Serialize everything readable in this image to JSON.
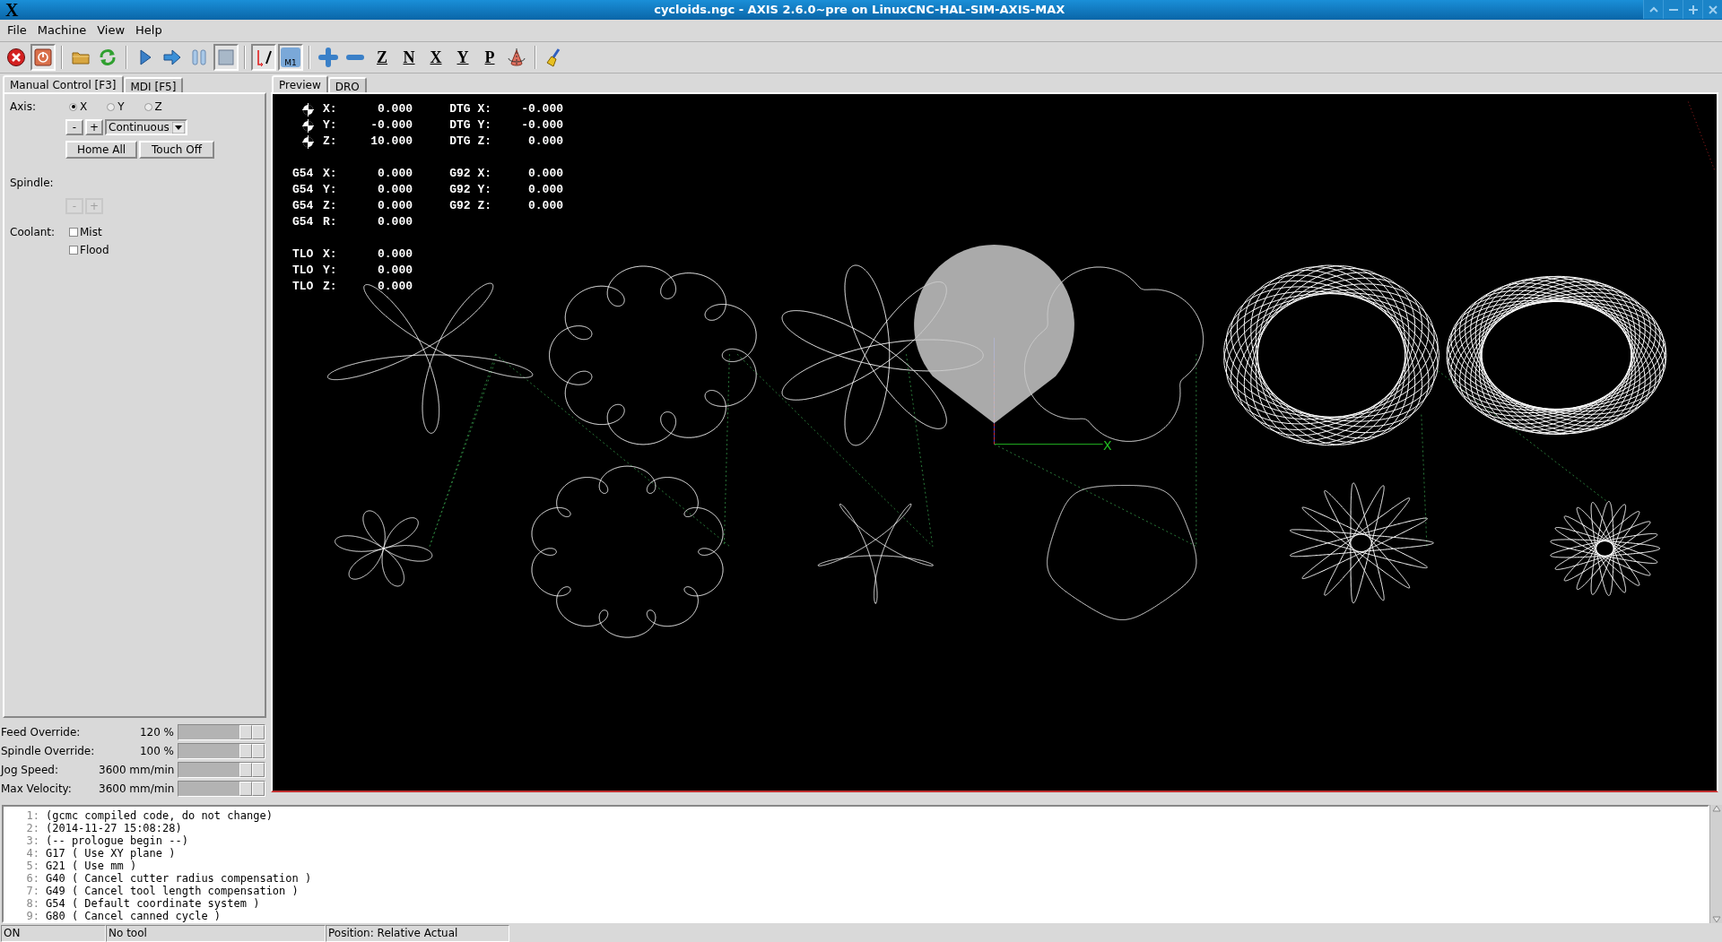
{
  "window": {
    "logo": "X",
    "title": "cycloids.ngc - AXIS 2.6.0~pre on LinuxCNC-HAL-SIM-AXIS-MAX"
  },
  "menu": [
    "File",
    "Machine",
    "View",
    "Help"
  ],
  "toolbar": [
    {
      "kind": "estop",
      "pressed": false
    },
    {
      "kind": "power",
      "pressed": true
    },
    {
      "kind": "separator"
    },
    {
      "kind": "open",
      "pressed": false
    },
    {
      "kind": "reload",
      "pressed": false
    },
    {
      "kind": "separator"
    },
    {
      "kind": "run",
      "pressed": false
    },
    {
      "kind": "step",
      "pressed": false
    },
    {
      "kind": "pause",
      "pressed": false
    },
    {
      "kind": "stop",
      "pressed": true
    },
    {
      "kind": "separator"
    },
    {
      "kind": "blockdelete",
      "pressed": true
    },
    {
      "kind": "optstop",
      "glyph": "M1",
      "pressed": true
    },
    {
      "kind": "separator"
    },
    {
      "kind": "zoomin",
      "pressed": false
    },
    {
      "kind": "zoomout",
      "pressed": false
    },
    {
      "kind": "view",
      "glyph": "Z",
      "pressed": false
    },
    {
      "kind": "view",
      "glyph": "N",
      "pressed": false
    },
    {
      "kind": "view",
      "glyph": "X",
      "pressed": false
    },
    {
      "kind": "view",
      "glyph": "Y",
      "pressed": false
    },
    {
      "kind": "view",
      "glyph": "P",
      "pressed": false
    },
    {
      "kind": "rotate",
      "pressed": false
    },
    {
      "kind": "separator"
    },
    {
      "kind": "clear",
      "pressed": false
    }
  ],
  "left_tabs": [
    {
      "label": "Manual Control [F3]",
      "selected": true
    },
    {
      "label": "MDI [F5]",
      "selected": false
    }
  ],
  "manual": {
    "axis_label": "Axis:",
    "axes": [
      {
        "label": "X",
        "selected": true
      },
      {
        "label": "Y",
        "selected": false
      },
      {
        "label": "Z",
        "selected": false
      }
    ],
    "jog_minus": "-",
    "jog_plus": "+",
    "jog_mode": "Continuous",
    "home_button": "Home All",
    "touch_button": "Touch Off",
    "spindle_label": "Spindle:",
    "spindle_minus": {
      "label": "-",
      "disabled": true
    },
    "spindle_plus": {
      "label": "+",
      "disabled": true
    },
    "coolant_label": "Coolant:",
    "coolant": [
      {
        "label": "Mist",
        "checked": false
      },
      {
        "label": "Flood",
        "checked": false
      }
    ]
  },
  "overrides": [
    {
      "kind": "percent",
      "label": "Feed Override:",
      "value": "120 %",
      "level": 1
    },
    {
      "kind": "percent",
      "label": "Spindle Override:",
      "value": "100 %",
      "level": 1
    },
    {
      "kind": "speed",
      "label": "Jog Speed:",
      "value": "3600 mm/min",
      "level": 1
    },
    {
      "kind": "speed",
      "label": "Max Velocity:",
      "value": "3600 mm/min",
      "level": 1
    }
  ],
  "preview_tabs": [
    {
      "label": "Preview",
      "selected": true
    },
    {
      "label": "DRO",
      "selected": false
    }
  ],
  "dro": [
    {
      "kind": "homed",
      "cells": [
        "",
        "X:",
        "0.000",
        "DTG X:",
        "-0.000"
      ]
    },
    {
      "kind": "homed",
      "cells": [
        "",
        "Y:",
        "-0.000",
        "DTG Y:",
        "-0.000"
      ]
    },
    {
      "kind": "homed",
      "cells": [
        "",
        "Z:",
        "10.000",
        "DTG Z:",
        "0.000"
      ]
    },
    {
      "kind": "blank"
    },
    {
      "kind": "plain",
      "cells": [
        "G54",
        "X:",
        "0.000",
        "G92 X:",
        "0.000"
      ]
    },
    {
      "kind": "plain",
      "cells": [
        "G54",
        "Y:",
        "0.000",
        "G92 Y:",
        "0.000"
      ]
    },
    {
      "kind": "plain",
      "cells": [
        "G54",
        "Z:",
        "0.000",
        "G92 Z:",
        "0.000"
      ]
    },
    {
      "kind": "plain",
      "cells": [
        "G54",
        "R:",
        "0.000",
        "",
        ""
      ]
    },
    {
      "kind": "blank"
    },
    {
      "kind": "plain",
      "cells": [
        "TLO",
        "X:",
        "0.000",
        "",
        ""
      ]
    },
    {
      "kind": "plain",
      "cells": [
        "TLO",
        "Y:",
        "0.000",
        "",
        ""
      ]
    },
    {
      "kind": "plain",
      "cells": [
        "TLO",
        "Z:",
        "0.000",
        "",
        ""
      ]
    }
  ],
  "axis_label": "X",
  "code": [
    {
      "number": "1:",
      "text": "(gcmc compiled code, do not change)"
    },
    {
      "number": "2:",
      "text": "(2014-11-27 15:08:28)"
    },
    {
      "number": "3:",
      "text": "(-- prologue begin --)"
    },
    {
      "number": "4:",
      "text": "G17 ( Use XY plane )"
    },
    {
      "number": "5:",
      "text": "G21 ( Use mm )"
    },
    {
      "number": "6:",
      "text": "G40 ( Cancel cutter radius compensation )"
    },
    {
      "number": "7:",
      "text": "G49 ( Cancel tool length compensation )"
    },
    {
      "number": "8:",
      "text": "G54 ( Default coordinate system )"
    },
    {
      "number": "9:",
      "text": "G80 ( Cancel canned cycle )"
    }
  ],
  "status_bar": [
    "ON",
    "No tool",
    "Position: Relative Actual"
  ]
}
